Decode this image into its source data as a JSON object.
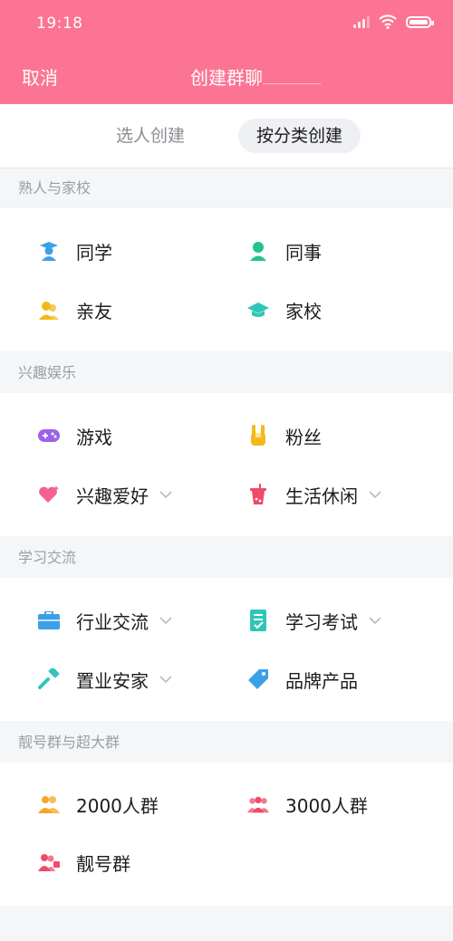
{
  "status_bar": {
    "time": "19:18"
  },
  "header": {
    "cancel_label": "取消",
    "title": "创建群聊"
  },
  "tabs": [
    {
      "label": "选人创建",
      "selected": false
    },
    {
      "label": "按分类创建",
      "selected": true
    }
  ],
  "sections": [
    {
      "title": "熟人与家校",
      "items": [
        {
          "label": "同学",
          "icon": "student-icon",
          "color": "#3ba0e8"
        },
        {
          "label": "同事",
          "icon": "colleague-icon",
          "color": "#22c38b"
        },
        {
          "label": "亲友",
          "icon": "friends-icon",
          "color": "#f5b81c"
        },
        {
          "label": "家校",
          "icon": "school-cap-icon",
          "color": "#2fc6b8"
        }
      ]
    },
    {
      "title": "兴趣娱乐",
      "items": [
        {
          "label": "游戏",
          "icon": "gamepad-icon",
          "color": "#9b63e8"
        },
        {
          "label": "粉丝",
          "icon": "rock-hand-icon",
          "color": "#f5b81c"
        },
        {
          "label": "兴趣爱好",
          "icon": "heart-icon",
          "color": "#f06292",
          "has_dropdown": true
        },
        {
          "label": "生活休闲",
          "icon": "drink-cup-icon",
          "color": "#ef4c6a",
          "has_dropdown": true
        }
      ]
    },
    {
      "title": "学习交流",
      "items": [
        {
          "label": "行业交流",
          "icon": "briefcase-icon",
          "color": "#3ba0e8",
          "has_dropdown": true
        },
        {
          "label": "学习考试",
          "icon": "exam-paper-icon",
          "color": "#2fc6b8",
          "has_dropdown": true
        },
        {
          "label": "置业安家",
          "icon": "paint-roller-icon",
          "color": "#2fc6b8",
          "has_dropdown": true
        },
        {
          "label": "品牌产品",
          "icon": "price-tag-icon",
          "color": "#3ba0e8"
        }
      ]
    },
    {
      "title": "靓号群与超大群",
      "items": [
        {
          "label": "2000人群",
          "icon": "group-2000-icon",
          "color": "#f5a623"
        },
        {
          "label": "3000人群",
          "icon": "group-3000-icon",
          "color": "#ef4c6a"
        },
        {
          "label": "靓号群",
          "icon": "vip-group-icon",
          "color": "#ef4c6a"
        }
      ]
    }
  ]
}
